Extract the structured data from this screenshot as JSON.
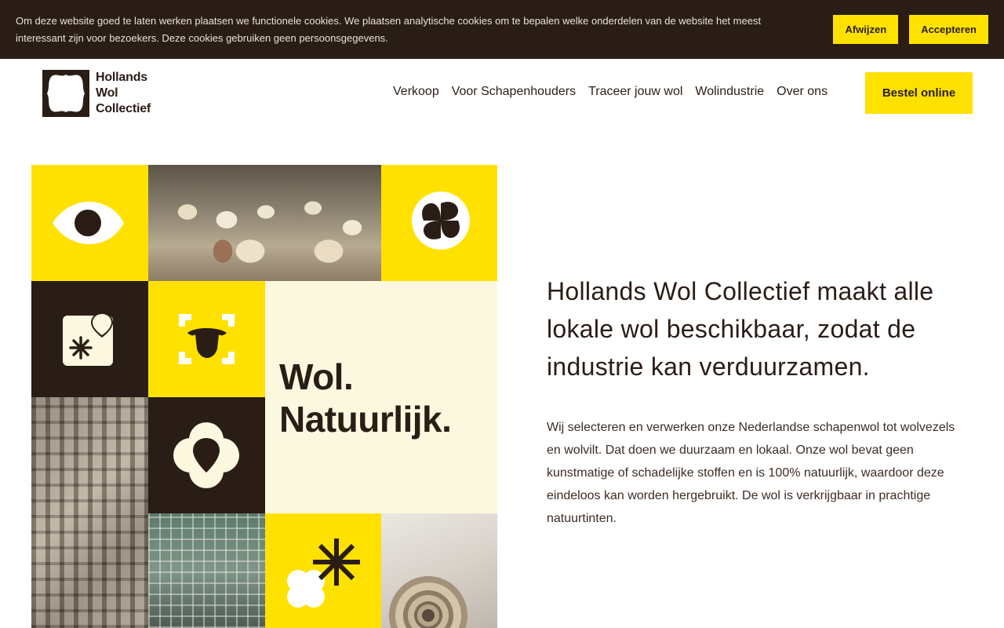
{
  "cookie_bar": {
    "message": "Om deze website goed te laten werken plaatsen we functionele cookies. We plaatsen analytische cookies om te bepalen welke onderdelen van de website het meest interessant zijn voor bezoekers. Deze cookies gebruiken geen persoonsgegevens.",
    "reject_label": "Afwijzen",
    "accept_label": "Accepteren"
  },
  "header": {
    "logo_lines": [
      "Hollands",
      "Wol",
      "Collectief"
    ],
    "nav": [
      "Verkoop",
      "Voor Schapenhouders",
      "Traceer jouw wol",
      "Wolindustrie",
      "Over ons"
    ],
    "cta_label": "Bestel online"
  },
  "mosaic": {
    "title_lines": [
      "Wol.",
      "Natuurlijk."
    ],
    "icons": [
      "eye-icon",
      "flower-icon",
      "asterisk-pin-icon",
      "sheep-scan-icon",
      "location-pin-flower-icon",
      "asterisk-cloud-icon"
    ]
  },
  "intro": {
    "heading": "Hollands Wol Collectief maakt alle lokale wol beschikbaar, zodat de industrie kan verduurzamen.",
    "body": "Wij selecteren en verwerken onze Nederlandse schapenwol tot wolvezels en wolvilt. Dat doen we duurzaam en lokaal. Onze wol bevat geen kunstmatige of schadelijke stoffen en is 100% natuurlijk, waardoor deze eindeloos kan worden hergebruikt. De wol is verkrijgbaar in prachtige natuurtinten."
  },
  "colors": {
    "brand_yellow": "#ffe100",
    "brand_dark": "#2a1d16",
    "cream": "#fbf8df"
  }
}
